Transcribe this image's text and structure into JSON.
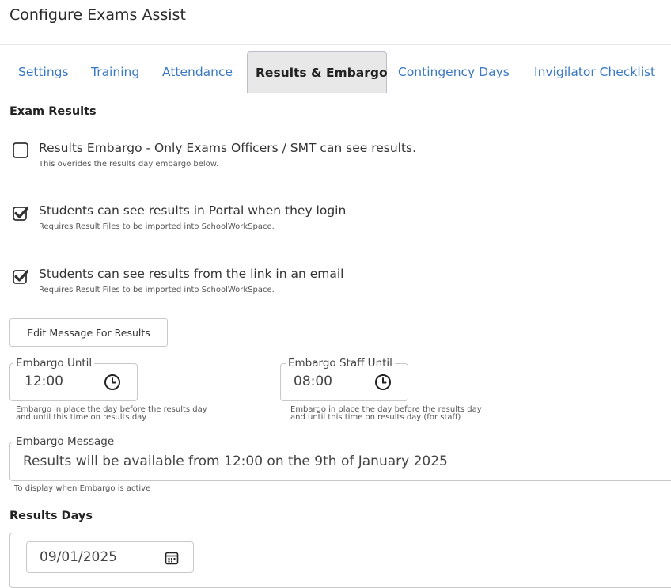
{
  "page": {
    "title": "Configure Exams Assist"
  },
  "tabs": [
    {
      "label": "Settings",
      "active": false
    },
    {
      "label": "Training",
      "active": false
    },
    {
      "label": "Attendance",
      "active": false
    },
    {
      "label": "Results & Embargo",
      "active": true
    },
    {
      "label": "Contingency Days",
      "active": false
    },
    {
      "label": "Invigilator Checklist",
      "active": false
    }
  ],
  "exam_results": {
    "heading": "Exam Results",
    "options": [
      {
        "label": "Results Embargo - Only Exams Officers / SMT can see results.",
        "help": "This overides the results day embargo below.",
        "checked": false
      },
      {
        "label": "Students can see results in Portal when they login",
        "help": "Requires Result Files to be imported into SchoolWorkSpace.",
        "checked": true
      },
      {
        "label": "Students can see results from the link in an email",
        "help": "Requires Result Files to be imported into SchoolWorkSpace.",
        "checked": true
      }
    ],
    "edit_message_button": "Edit Message For Results"
  },
  "embargo_until": {
    "label": "Embargo Until",
    "value": "12:00",
    "help_line1": "Embargo in place the day before the results day",
    "help_line2": "and until this time on results day"
  },
  "embargo_staff_until": {
    "label": "Embargo Staff Until",
    "value": "08:00",
    "help_line1": "Embargo in place the day before the results day",
    "help_line2": "and until this time on results day (for staff)"
  },
  "embargo_message": {
    "label": "Embargo Message",
    "value": "Results will be available from 12:00 on the 9th of January 2025",
    "help": "To display when Embargo is active"
  },
  "results_days": {
    "heading": "Results Days",
    "date_value": "09/01/2025"
  },
  "icons": {
    "clock": "clock-icon",
    "calendar": "calendar-icon",
    "checkmark": "checkmark-icon"
  },
  "colors": {
    "tab_link": "#3a78c2",
    "active_tab_bg": "#e8e8e8"
  }
}
